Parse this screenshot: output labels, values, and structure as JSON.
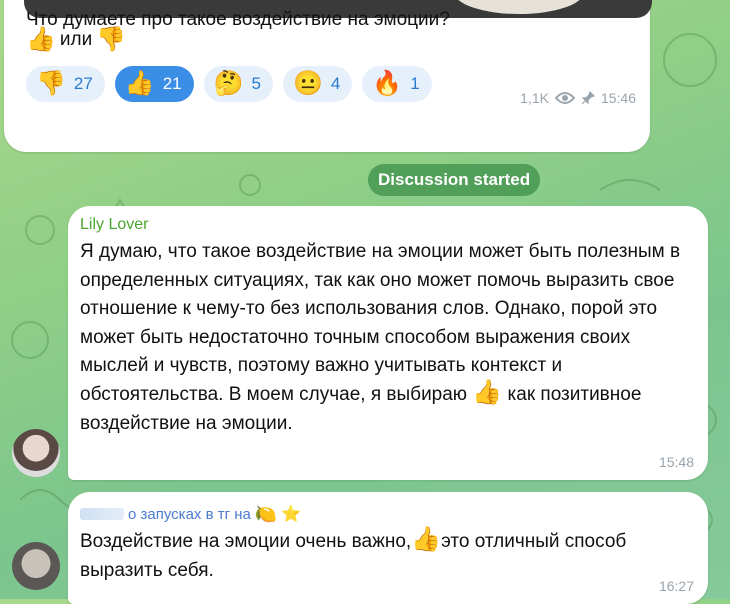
{
  "post": {
    "question": "Что думаете про такое воздействие на эмоции?",
    "choice_separator": "или",
    "choice_first_icon": "👍",
    "choice_second_icon": "👎",
    "reactions": [
      {
        "icon": "👎",
        "count": "27",
        "active": false
      },
      {
        "icon": "👍",
        "count": "21",
        "active": true
      },
      {
        "icon": "🤔",
        "count": "5",
        "active": false
      },
      {
        "icon": "😐",
        "count": "4",
        "active": false
      },
      {
        "icon": "🔥",
        "count": "1",
        "active": false
      }
    ],
    "views": "1,1K",
    "time": "15:46"
  },
  "discussion_label": "Discussion started",
  "comments": [
    {
      "author": "Lily Lover",
      "text_before": "Я думаю, что такое воздействие на эмоции может быть полезным в определенных ситуациях, так как оно может помочь выразить свое отношение к чему-то без использования слов. Однако, порой это может быть недостаточно точным способом выражения своих мыслей и чувств, поэтому важно учитывать контекст и обстоятельства. В моем случае, я выбираю",
      "inline_icon": "👍",
      "text_after": "как позитивное воздействие на эмоции.",
      "time": "15:48"
    },
    {
      "author": "о запусках в тг на",
      "author_icon": "🍋",
      "badge_icon": "⭐",
      "text_before": "Воздействие на эмоции очень важно,",
      "inline_icon": "👍",
      "text_after": "это отличный способ выразить себя.",
      "time": "16:27"
    }
  ],
  "colors": {
    "author1": "#4aa52e",
    "author2": "#4a7bd0",
    "reaction_bg": "#e6f0fb",
    "reaction_active": "#3a8ee6"
  }
}
